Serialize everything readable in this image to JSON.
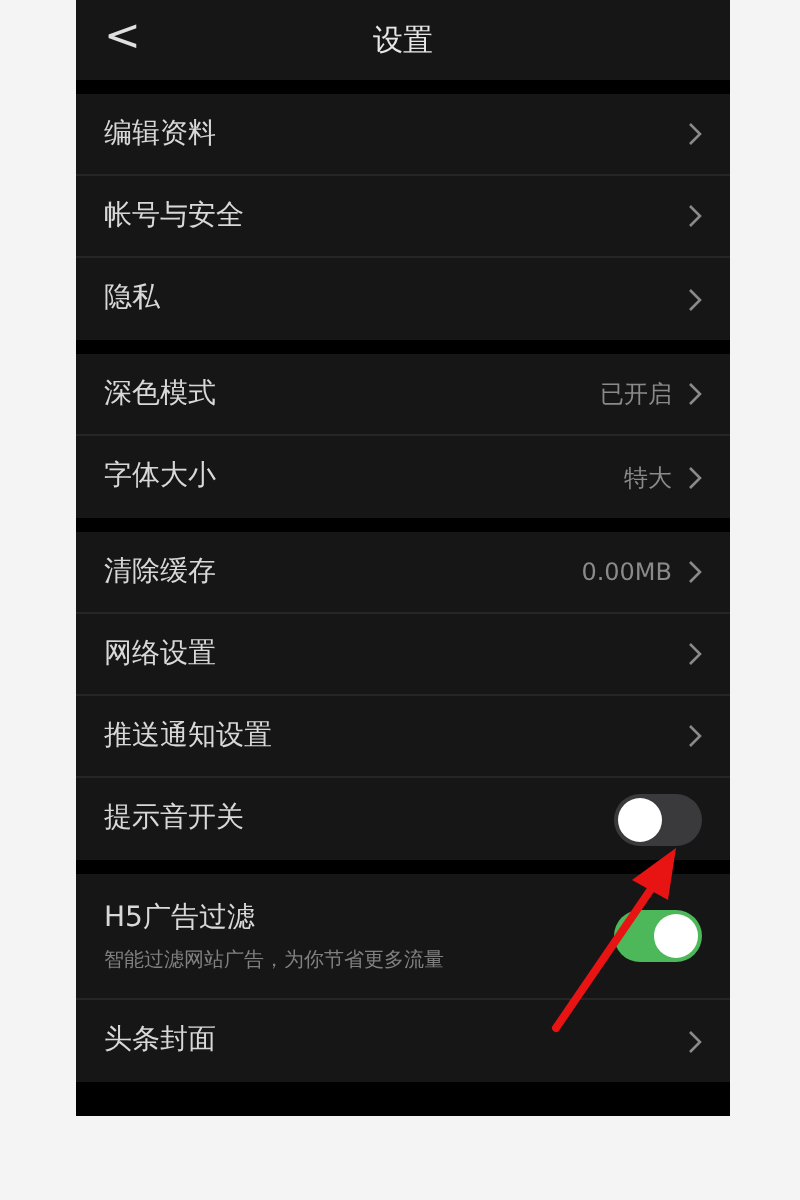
{
  "header": {
    "back": "<",
    "title": "设置"
  },
  "sections": [
    {
      "items": [
        {
          "kind": "link",
          "label": "编辑资料"
        },
        {
          "kind": "link",
          "label": "帐号与安全"
        },
        {
          "kind": "link",
          "label": "隐私"
        }
      ]
    },
    {
      "items": [
        {
          "kind": "link",
          "label": "深色模式",
          "value": "已开启"
        },
        {
          "kind": "link",
          "label": "字体大小",
          "value": "特大"
        }
      ]
    },
    {
      "items": [
        {
          "kind": "link",
          "label": "清除缓存",
          "value": "0.00MB"
        },
        {
          "kind": "link",
          "label": "网络设置"
        },
        {
          "kind": "link",
          "label": "推送通知设置"
        },
        {
          "kind": "toggle",
          "label": "提示音开关",
          "on": false
        }
      ]
    },
    {
      "items": [
        {
          "kind": "toggle",
          "label": "H5广告过滤",
          "sublabel": "智能过滤网站广告，为你节省更多流量",
          "on": true
        },
        {
          "kind": "link",
          "label": "头条封面"
        }
      ]
    }
  ]
}
